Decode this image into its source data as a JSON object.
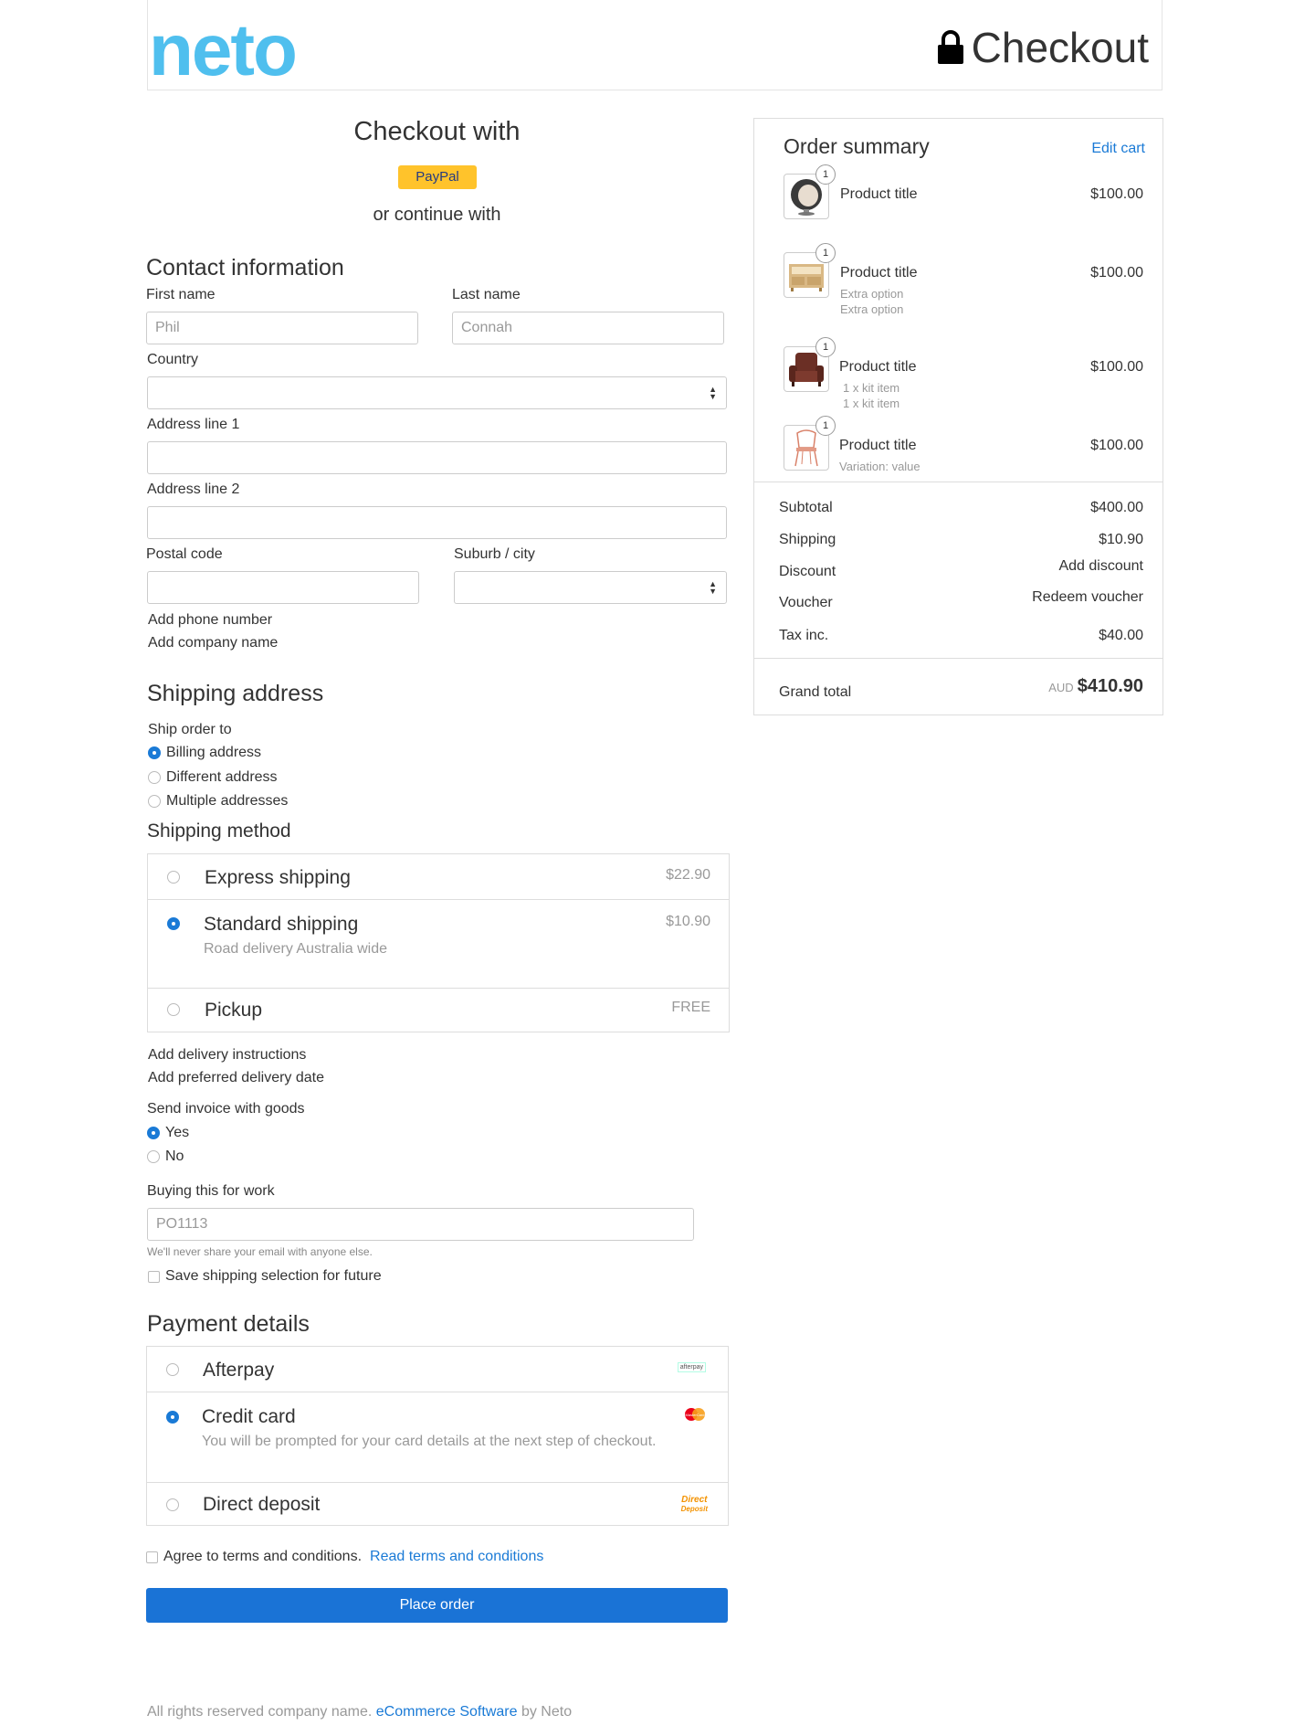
{
  "header": {
    "logo": "neto",
    "title": "Checkout"
  },
  "express": {
    "heading": "Checkout with",
    "paypal": "PayPal",
    "or_continue": "or continue with"
  },
  "contact": {
    "heading": "Contact information",
    "first_name_label": "First name",
    "first_name_value": "Phil",
    "last_name_label": "Last name",
    "last_name_value": "Connah",
    "country_label": "Country",
    "country_value": "",
    "address1_label": "Address line 1",
    "address1_value": "",
    "address2_label": "Address line 2",
    "address2_value": "",
    "postal_label": "Postal code",
    "postal_value": "",
    "suburb_label": "Suburb / city",
    "suburb_value": "",
    "add_phone": "Add phone number",
    "add_company": "Add company name"
  },
  "shipping_address": {
    "heading": "Shipping address",
    "ship_to_label": "Ship order to",
    "options": [
      "Billing address",
      "Different address",
      "Multiple addresses"
    ],
    "selected": "Billing address"
  },
  "shipping_method": {
    "heading": "Shipping method",
    "options": [
      {
        "title": "Express shipping",
        "price": "$22.90",
        "note": ""
      },
      {
        "title": "Standard shipping",
        "price": "$10.90",
        "note": "Road delivery Australia wide"
      },
      {
        "title": "Pickup",
        "price": "FREE",
        "note": ""
      }
    ],
    "selected": "Standard shipping"
  },
  "delivery": {
    "add_instructions": "Add delivery instructions",
    "add_date": "Add preferred delivery date",
    "invoice_label": "Send invoice with goods",
    "invoice_yes": "Yes",
    "invoice_no": "No",
    "work_label": "Buying this for work",
    "po_value": "PO1113",
    "help_text": "We'll never share your email with anyone else.",
    "save_selection": "Save shipping selection for future"
  },
  "payment": {
    "heading": "Payment details",
    "options": [
      {
        "title": "Afterpay",
        "note": "",
        "logo": "afterpay"
      },
      {
        "title": "Credit card",
        "note": "You will be prompted for your card details at the next step of checkout.",
        "logo": "mastercard"
      },
      {
        "title": "Direct deposit",
        "note": "",
        "logo": "Direct Deposit"
      }
    ],
    "selected": "Credit card",
    "direct_logo_line1": "Direct",
    "direct_logo_line2": "Deposit",
    "afterpay_logo": "afterpay",
    "mastercard_logo": "MasterCard"
  },
  "terms": {
    "agree": "Agree to terms and conditions.",
    "read": "Read terms and conditions"
  },
  "place_order": "Place order",
  "footer": {
    "text": "All rights reserved company name.",
    "link": "eCommerce Software",
    "by": "by Neto"
  },
  "summary": {
    "heading": "Order summary",
    "edit_cart": "Edit cart",
    "items": [
      {
        "qty": "1",
        "title": "Product title",
        "price": "$100.00",
        "sub1": "",
        "sub2": "",
        "icon": "ball-chair"
      },
      {
        "qty": "1",
        "title": "Product title",
        "price": "$100.00",
        "sub1": "Extra option",
        "sub2": "Extra option",
        "icon": "tv-cabinet"
      },
      {
        "qty": "1",
        "title": "Product title",
        "price": "$100.00",
        "sub1": "1 x kit item",
        "sub2": "1 x kit item",
        "icon": "armchair"
      },
      {
        "qty": "1",
        "title": "Product title",
        "price": "$100.00",
        "sub1": "Variation: value",
        "sub2": "",
        "icon": "chair"
      }
    ],
    "subtotal_label": "Subtotal",
    "subtotal": "$400.00",
    "shipping_label": "Shipping",
    "shipping": "$10.90",
    "discount_label": "Discount",
    "discount_link": "Add discount",
    "voucher_label": "Voucher",
    "voucher_link": "Redeem voucher",
    "tax_label": "Tax inc.",
    "tax": "$40.00",
    "grand_label": "Grand total",
    "currency": "AUD",
    "grand": "$410.90"
  },
  "colors": {
    "accent": "#1a7ad6",
    "logo": "#4fbfee",
    "paypal": "#ffc32b",
    "button": "#1a73d6"
  }
}
